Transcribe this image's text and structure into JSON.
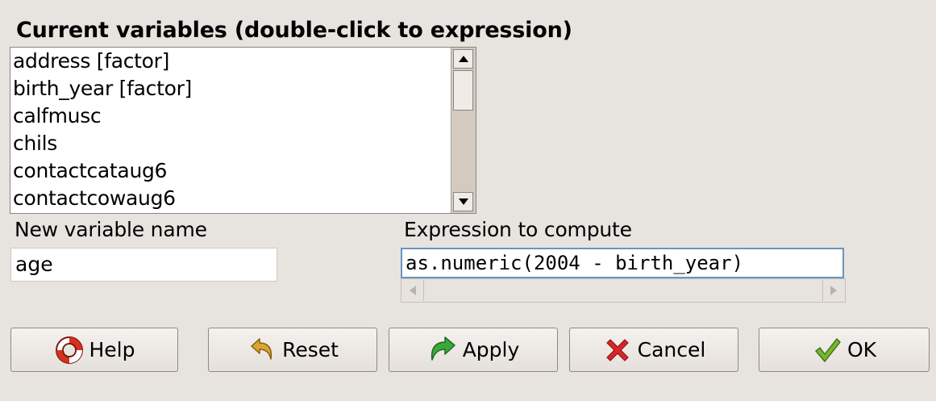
{
  "variables_section": {
    "title": "Current variables (double-click to expression)",
    "items": [
      "address [factor]",
      "birth_year [factor]",
      "calfmusc",
      "chils",
      "contactcataug6",
      "contactcowaug6"
    ]
  },
  "new_variable": {
    "label": "New variable name",
    "value": "age"
  },
  "expression": {
    "label": "Expression to compute",
    "value": "as.numeric(2004 - birth_year)"
  },
  "buttons": {
    "help": "Help",
    "reset": "Reset",
    "apply": "Apply",
    "cancel": "Cancel",
    "ok": "OK"
  },
  "icons": {
    "help": "lifebuoy-icon",
    "reset": "undo-arrow-icon",
    "apply": "redo-arrow-icon",
    "cancel": "red-x-icon",
    "ok": "checkmark-icon"
  },
  "colors": {
    "background": "#e7e3df",
    "focus_border": "#6a95be",
    "cancel_red": "#d8262b",
    "ok_green": "#6cae2a",
    "apply_green": "#37a33a",
    "reset_gold": "#c8901e"
  }
}
